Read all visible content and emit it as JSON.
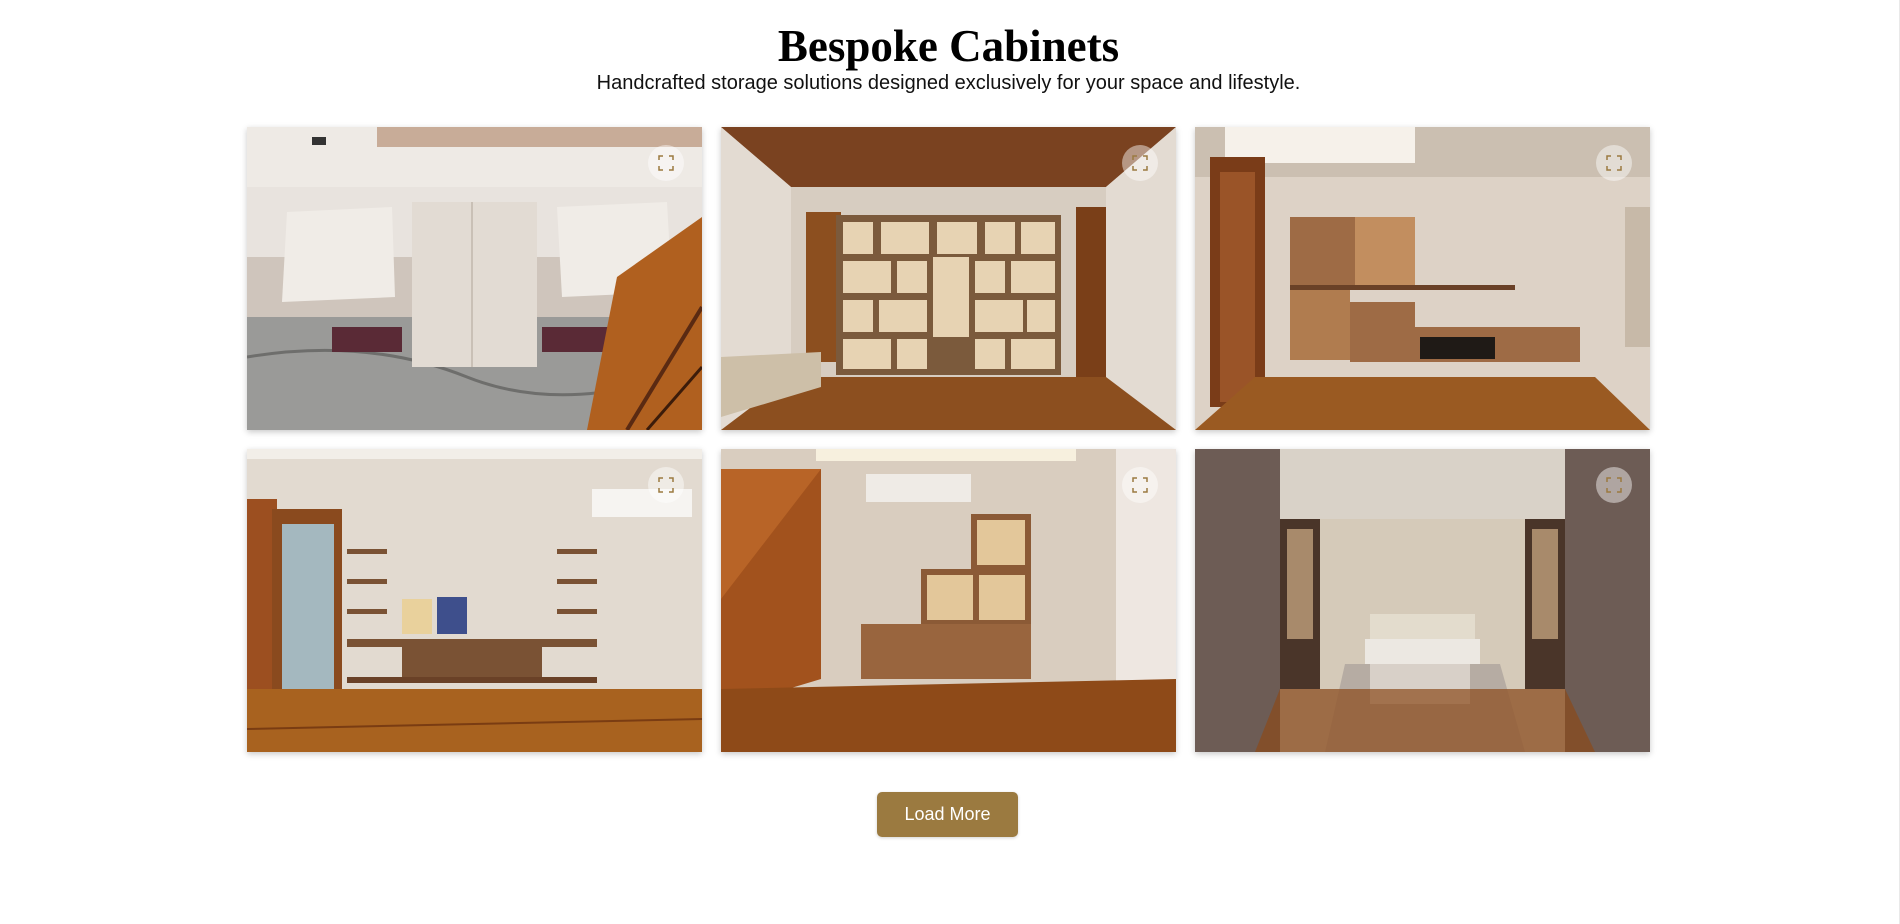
{
  "header": {
    "title": "Bespoke Cabinets",
    "subtitle": "Handcrafted storage solutions designed exclusively for your space and lifestyle."
  },
  "gallery": {
    "items": [
      {
        "image": "kitchen-cabinets-with-lift-up-doors"
      },
      {
        "image": "walnut-bookshelf-wall"
      },
      {
        "image": "floating-wood-cabinets-with-lighting"
      },
      {
        "image": "living-room-floating-shelves"
      },
      {
        "image": "stepped-illuminated-cabinet"
      },
      {
        "image": "bedroom-with-built-in-niches"
      }
    ],
    "expand_icon": "expand-icon"
  },
  "actions": {
    "load_more_label": "Load More"
  },
  "colors": {
    "accent": "#9b7a40",
    "wood": "#8a4a1e",
    "wall": "#d9cfc3"
  }
}
